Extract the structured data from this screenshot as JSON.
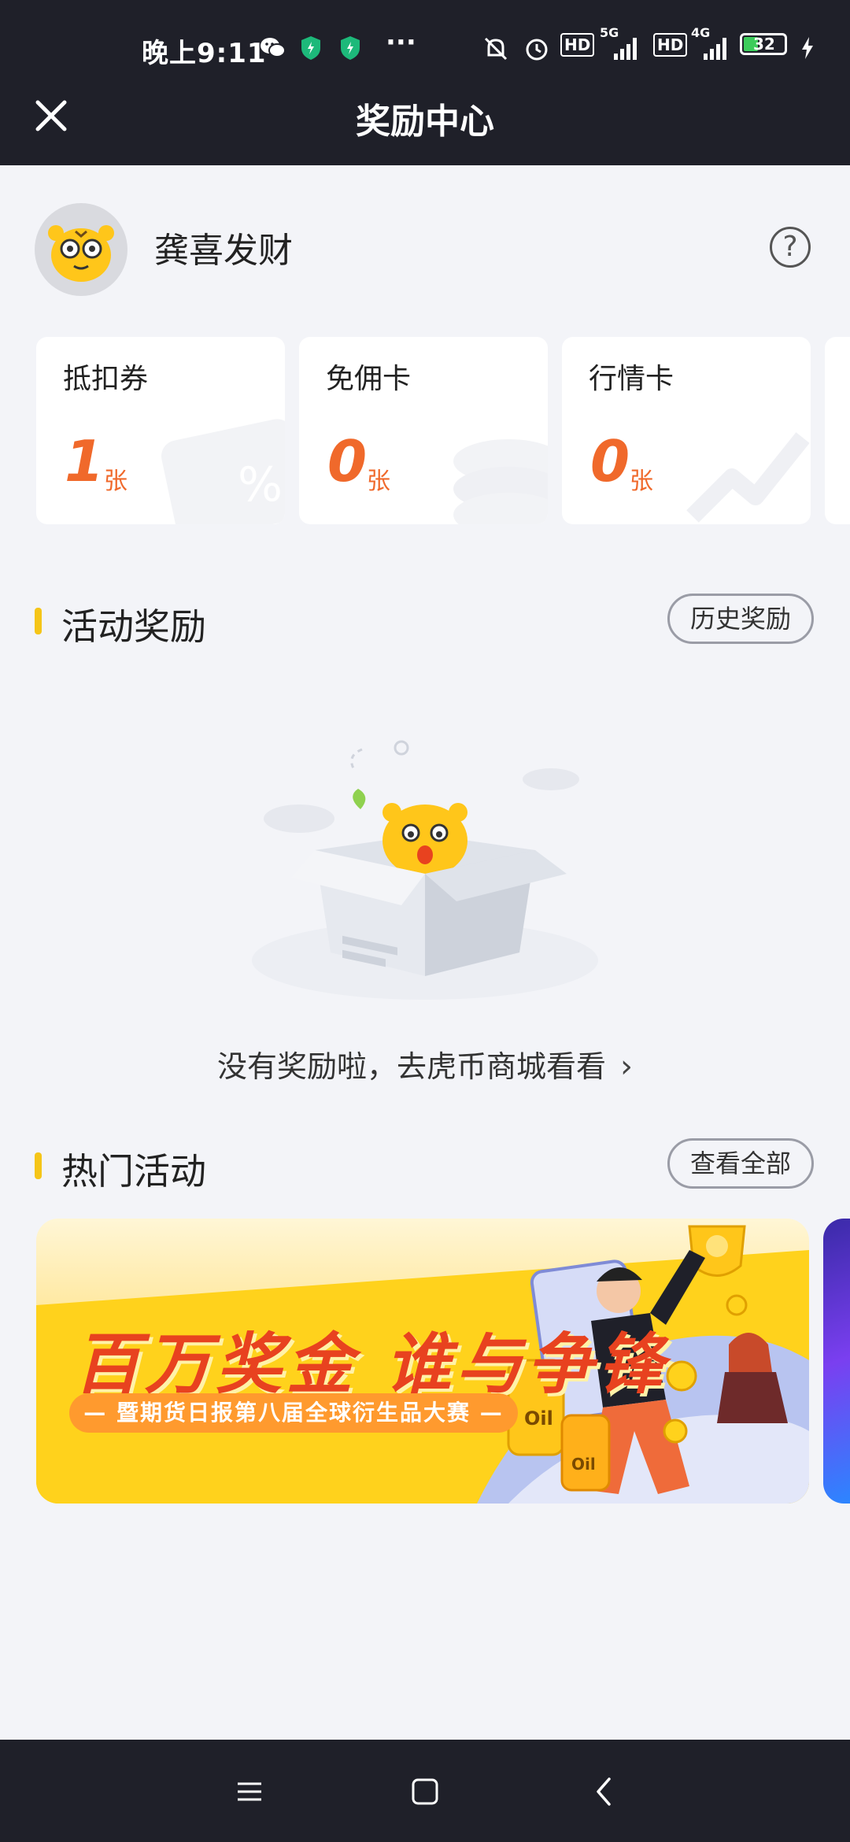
{
  "status_bar": {
    "time": "晚上9:11",
    "battery": "32",
    "net1": "5G",
    "net2": "4G",
    "hd": "HD",
    "more": "···"
  },
  "header": {
    "title": "奖励中心"
  },
  "profile": {
    "username": "龚喜发财"
  },
  "cards": [
    {
      "name": "抵扣券",
      "count": "1",
      "unit": "张"
    },
    {
      "name": "免佣卡",
      "count": "0",
      "unit": "张"
    },
    {
      "name": "行情卡",
      "count": "0",
      "unit": "张"
    }
  ],
  "rewards_section": {
    "title": "活动奖励",
    "history_button": "历史奖励"
  },
  "empty_state": {
    "text": "没有奖励啦，去虎币商城看看"
  },
  "hot_section": {
    "title": "热门活动",
    "view_all_button": "查看全部"
  },
  "banner": {
    "headline": "百万奖金 谁与争锋",
    "subtitle": "— 暨期货日报第八届全球衍生品大赛 —",
    "oil_label": "Oil"
  },
  "colors": {
    "accent": "#f5c518",
    "count_color": "#f0692b",
    "topbar": "#1f2029"
  }
}
